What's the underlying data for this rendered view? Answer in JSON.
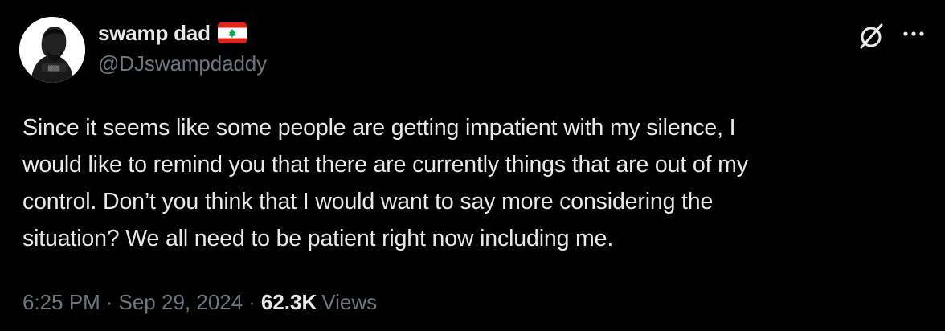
{
  "author": {
    "display_name": "swamp dad",
    "flag_icon": "lebanon-flag-icon",
    "handle": "@DJswampdaddy",
    "avatar_icon": "profile-avatar"
  },
  "actions": {
    "grok_icon": "grok-icon",
    "more_icon": "more-options-icon"
  },
  "tweet": {
    "lines": [
      "Since it seems like some people are getting impatient with my silence, I",
      "would like to remind you that there are currently things that are out of my",
      "control. Don’t you think that I would want to say more considering the",
      "situation? We all need to be patient right now including me."
    ]
  },
  "meta": {
    "time": "6:25 PM",
    "separator": "·",
    "date": "Sep 29, 2024",
    "views_count": "62.3K",
    "views_label": "Views"
  },
  "colors": {
    "background": "#000000",
    "primary_text": "#e7e9ea",
    "secondary_text": "#71767b",
    "flag_red": "#e2231a",
    "flag_cedar": "#00a651"
  }
}
